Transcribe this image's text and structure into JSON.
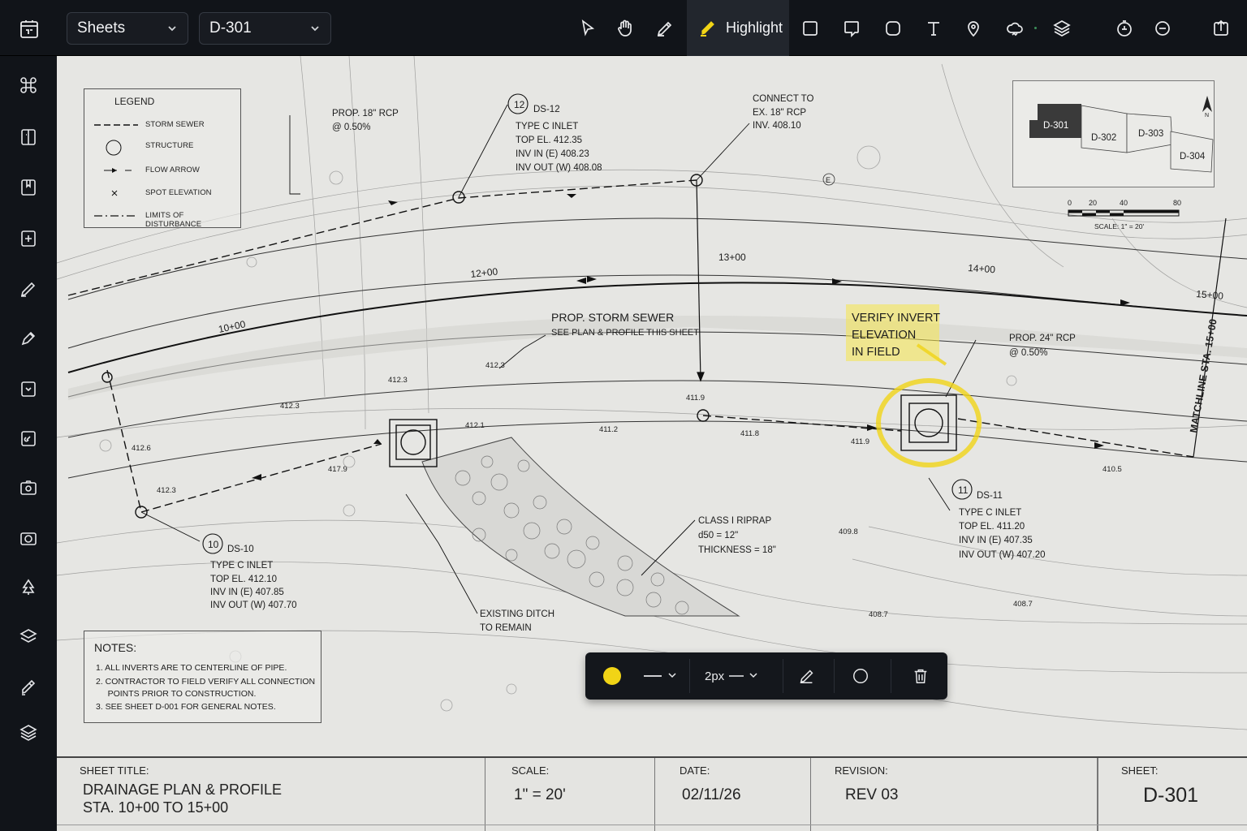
{
  "toolbar": {
    "sheets_select": "Sheets",
    "sheet_select": "D-301",
    "active_tool_label": "Highlight",
    "tools": [
      "select-tool",
      "pan-tool",
      "pen-tool",
      "highlight-tool",
      "rectangle-tool",
      "callout-tool",
      "rounded-rect-tool",
      "text-tool",
      "pin-tool",
      "cloud-tool",
      "layers-tool",
      "zoom-in-tool",
      "zoom-out-tool",
      "export-tool"
    ]
  },
  "sidebar": {
    "icons": [
      "command-icon",
      "book-icon",
      "bookmark-icon",
      "plus-box-icon",
      "pencil-icon",
      "pen-icon",
      "clip-icon",
      "link-icon",
      "camera-icon",
      "camera2-icon",
      "tree-icon",
      "layers-icon",
      "brush-icon",
      "stack-icon"
    ]
  },
  "legend": {
    "title": "LEGEND",
    "items": [
      "STORM SEWER",
      "STRUCTURE",
      "FLOW ARROW",
      "SPOT ELEVATION",
      "LIMITS OF DISTURBANCE"
    ]
  },
  "keymap": {
    "sheets": [
      "D-301",
      "D-302",
      "D-303",
      "D-304"
    ],
    "north": "N",
    "scale_ticks": [
      "0",
      "20",
      "40",
      "80"
    ],
    "scale_label": "SCALE: 1\" = 20'"
  },
  "annotations": {
    "prop_18": [
      "PROP. 18\" RCP",
      "@ 0.50%"
    ],
    "ds12": {
      "num": "12",
      "id": "DS-12",
      "lines": [
        "TYPE C INLET",
        "TOP EL. 412.35",
        "INV IN (E) 408.23",
        "INV OUT (W) 408.08"
      ]
    },
    "connect": [
      "CONNECT TO",
      "EX. 18\" RCP",
      "INV. 408.10"
    ],
    "e_marker": "E",
    "stations": [
      "10+00",
      "12+00",
      "13+00",
      "14+00",
      "15+00"
    ],
    "storm_title": "PROP. STORM SEWER",
    "storm_sub": "SEE PLAN & PROFILE THIS SHEET",
    "highlight": [
      "VERIFY INVERT",
      "ELEVATION",
      "IN FIELD"
    ],
    "prop_24": [
      "PROP. 24\" RCP",
      "@ 0.50%"
    ],
    "matchline": "MATCHLINE STA. 15+00",
    "spots": [
      "412.3",
      "412.3",
      "412.3",
      "412.6",
      "412.1",
      "411.2",
      "411.9",
      "411.8",
      "411.9",
      "417.9",
      "412.3",
      "410.5",
      "409.8",
      "408.7",
      "408.7"
    ],
    "ds11": {
      "num": "11",
      "id": "DS-11",
      "lines": [
        "TYPE C INLET",
        "TOP EL. 411.20",
        "INV IN (E) 407.35",
        "INV OUT (W) 407.20"
      ]
    },
    "ds10": {
      "num": "10",
      "id": "DS-10",
      "lines": [
        "TYPE C INLET",
        "TOP EL. 412.10",
        "INV IN (E) 407.85",
        "INV OUT (W) 407.70"
      ]
    },
    "riprap": [
      "CLASS I RIPRAP",
      "d50 = 12\"",
      "THICKNESS = 18\""
    ],
    "ditch": [
      "EXISTING DITCH",
      "TO REMAIN"
    ]
  },
  "notes": {
    "title": "NOTES:",
    "items": [
      "1.  ALL INVERTS ARE TO CENTERLINE OF PIPE.",
      "2.  CONTRACTOR TO FIELD VERIFY ALL CONNECTION",
      "     POINTS PRIOR TO CONSTRUCTION.",
      "3.  SEE SHEET D-001 FOR GENERAL NOTES."
    ]
  },
  "titleblock": {
    "sheet_title_label": "SHEET TITLE:",
    "sheet_title_1": "DRAINAGE PLAN & PROFILE",
    "sheet_title_2": "STA. 10+00 TO 15+00",
    "scale_label": "SCALE:",
    "scale_value": "1\" = 20'",
    "date_label": "DATE:",
    "date_value": "02/11/26",
    "revision_label": "REVISION:",
    "revision_value": "REV 03",
    "sheet_label": "SHEET:",
    "sheet_value": "D-301"
  },
  "annot_toolbar": {
    "color": "#f1d416",
    "thickness": "2px"
  },
  "colors": {
    "accent_yellow": "#f1d416",
    "paper": "#e6e6e3",
    "chrome": "#111419"
  }
}
